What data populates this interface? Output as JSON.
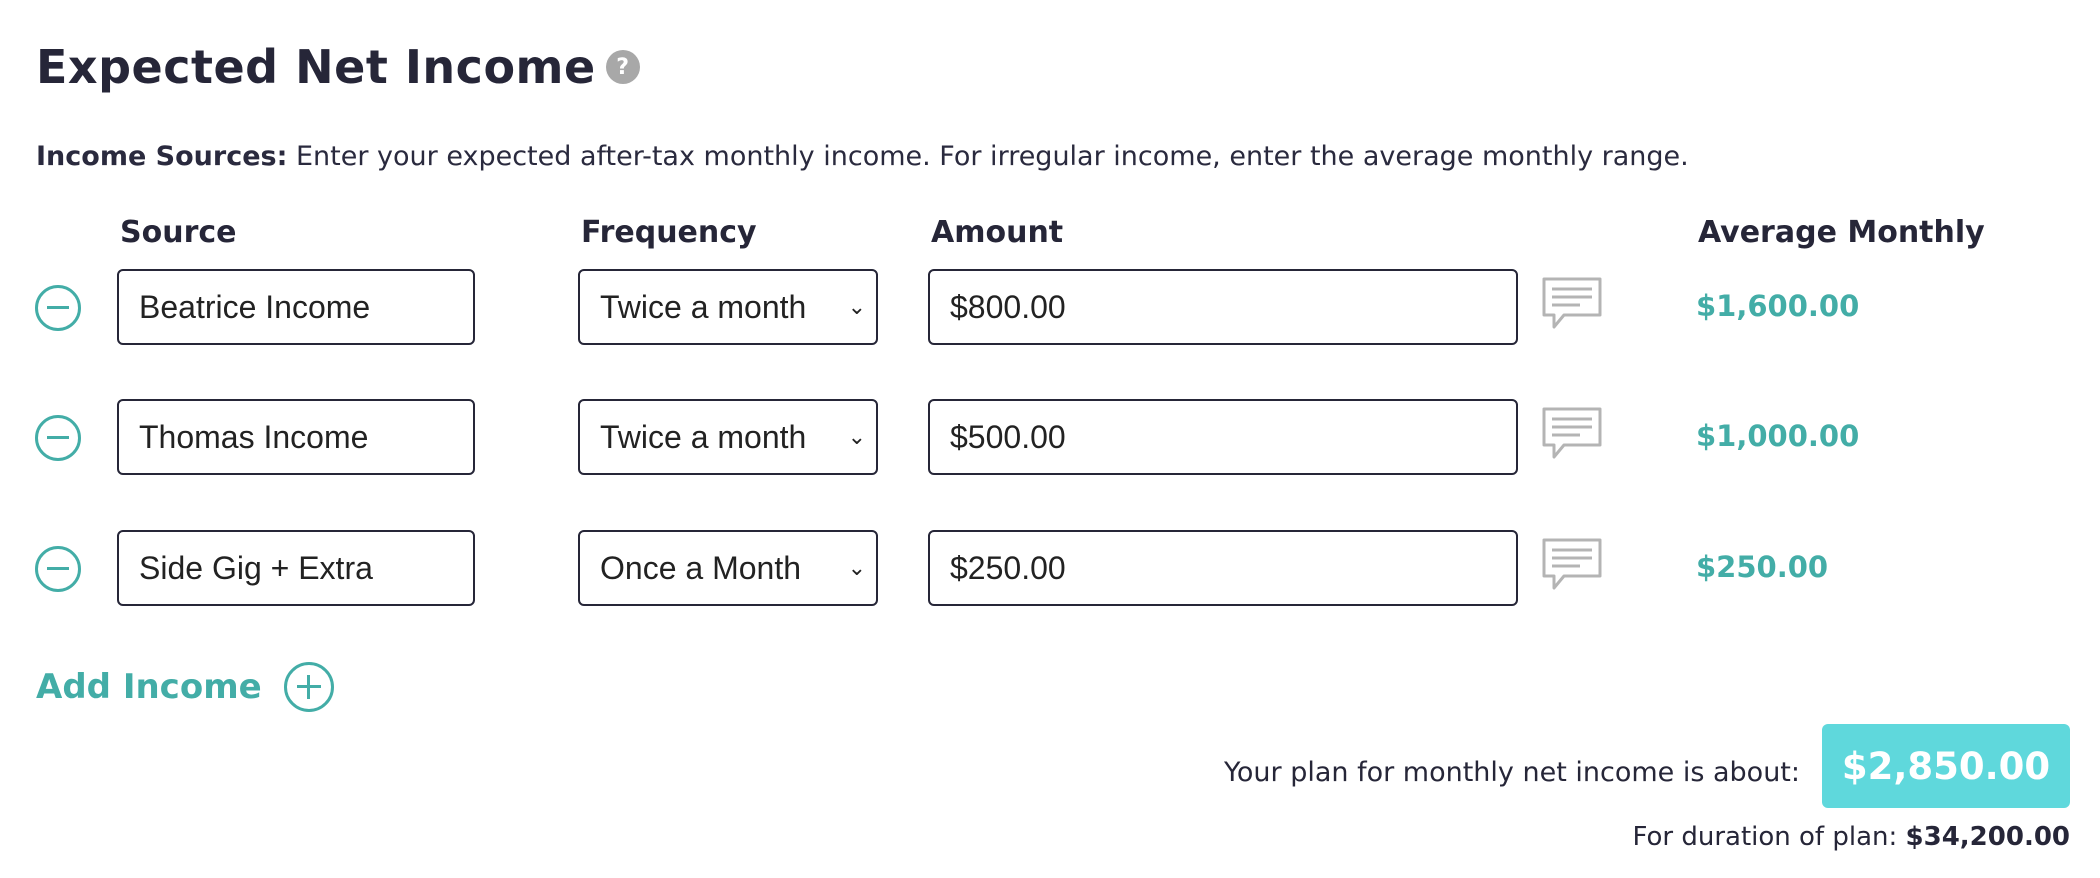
{
  "header": {
    "title": "Expected Net Income",
    "help_icon": "?"
  },
  "intro": {
    "label": "Income Sources:",
    "text": "Enter your expected after-tax monthly income. For irregular income, enter the average monthly range."
  },
  "columns": {
    "source": "Source",
    "frequency": "Frequency",
    "amount": "Amount",
    "average": "Average Monthly"
  },
  "incomes": [
    {
      "source": "Beatrice Income",
      "frequency": "Twice a month",
      "amount": "$800.00",
      "average": "$1,600.00"
    },
    {
      "source": "Thomas Income",
      "frequency": "Twice a month",
      "amount": "$500.00",
      "average": "$1,000.00"
    },
    {
      "source": "Side Gig + Extra",
      "frequency": "Once a Month",
      "amount": "$250.00",
      "average": "$250.00"
    }
  ],
  "add_income": {
    "label": "Add Income"
  },
  "summary": {
    "label": "Your plan for monthly net income is about:",
    "total": "$2,850.00",
    "duration_label": "For duration of plan:",
    "duration_total": "$34,200.00"
  },
  "colors": {
    "accent": "#43ada7",
    "badge": "#5fd8dc",
    "text": "#262638"
  }
}
